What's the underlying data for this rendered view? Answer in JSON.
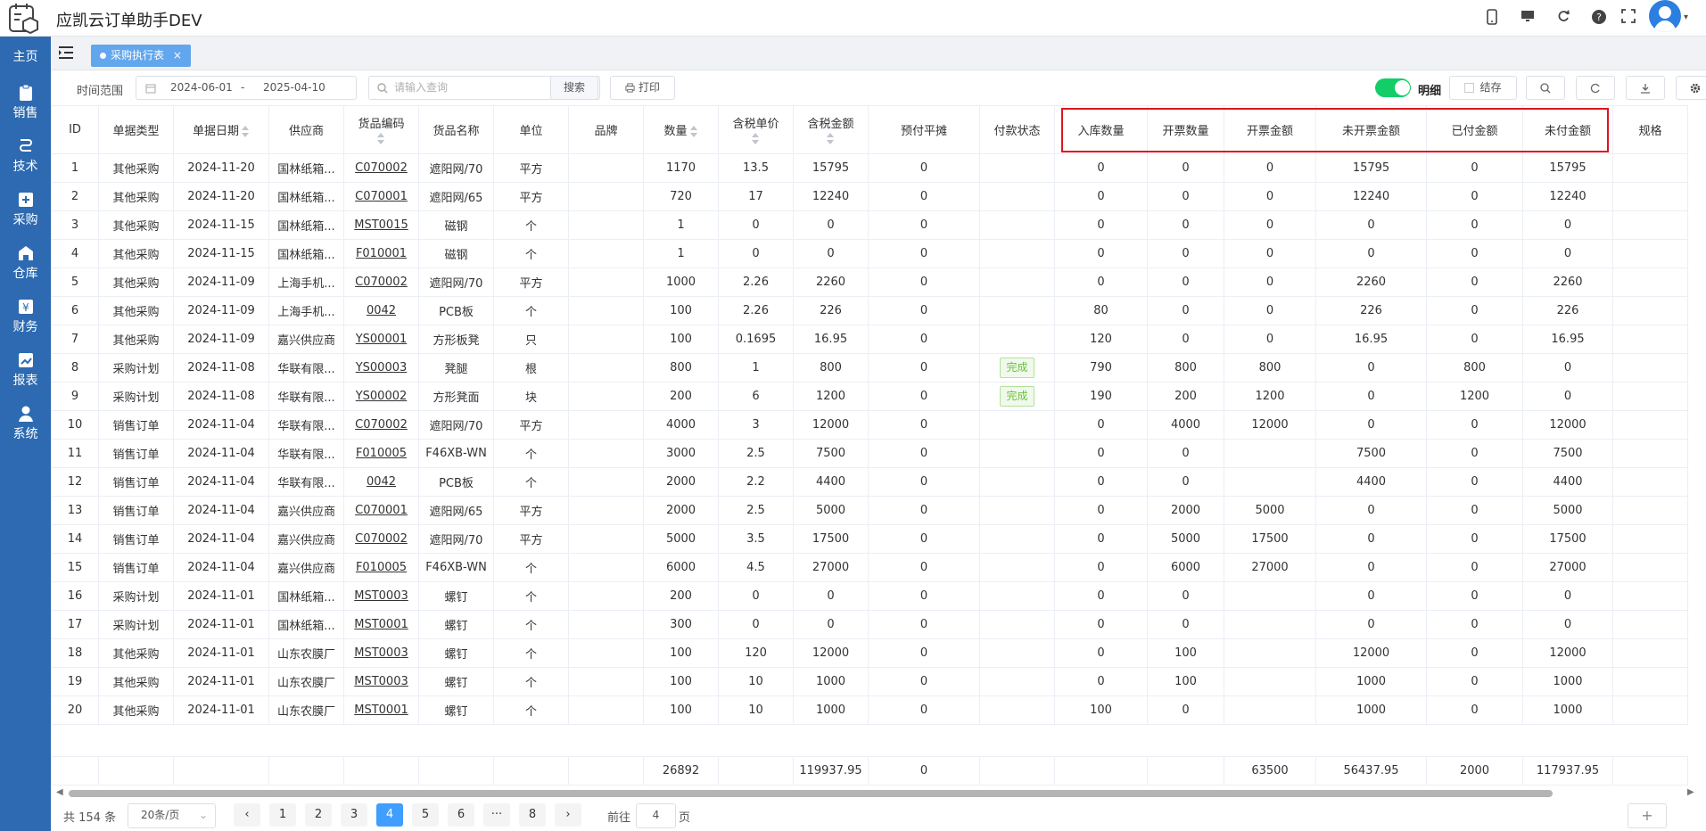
{
  "app": {
    "title": "应凯云订单助手DEV"
  },
  "sidebar": {
    "items": [
      {
        "label": "主页",
        "icon": "home-icon"
      },
      {
        "label": "销售",
        "icon": "clipboard-icon"
      },
      {
        "label": "技术",
        "icon": "route-icon"
      },
      {
        "label": "采购",
        "icon": "cart-icon"
      },
      {
        "label": "仓库",
        "icon": "warehouse-icon"
      },
      {
        "label": "财务",
        "icon": "yen-icon"
      },
      {
        "label": "报表",
        "icon": "chart-icon"
      },
      {
        "label": "系统",
        "icon": "user-icon"
      }
    ]
  },
  "tabs": {
    "active": "采购执行表",
    "close": "×"
  },
  "toolbar": {
    "date_label": "时间范围",
    "date_start": "2024-06-01",
    "date_sep": "-",
    "date_end": "2025-04-10",
    "search_placeholder": "请输入查询",
    "search_button": "搜索",
    "print_button": "打印",
    "detail_toggle_label": "明细",
    "detail_toggle_on": true,
    "settle_label": "结存"
  },
  "table": {
    "headers": [
      "ID",
      "单据类型",
      "单据日期",
      "供应商",
      "货品编码",
      "货品名称",
      "单位",
      "品牌",
      "数量",
      "含税单价",
      "含税金额",
      "预付平摊",
      "付款状态",
      "入库数量",
      "开票数量",
      "开票金额",
      "未开票金额",
      "已付金额",
      "未付金额",
      "规格"
    ],
    "rows": [
      [
        "1",
        "其他采购",
        "2024-11-20",
        "国林纸箱...",
        "C070002",
        "遮阳网/70",
        "平方",
        "",
        "1170",
        "13.5",
        "15795",
        "0",
        "",
        "0",
        "0",
        "0",
        "15795",
        "0",
        "15795",
        ""
      ],
      [
        "2",
        "其他采购",
        "2024-11-20",
        "国林纸箱...",
        "C070001",
        "遮阳网/65",
        "平方",
        "",
        "720",
        "17",
        "12240",
        "0",
        "",
        "0",
        "0",
        "0",
        "12240",
        "0",
        "12240",
        ""
      ],
      [
        "3",
        "其他采购",
        "2024-11-15",
        "国林纸箱...",
        "MST0015",
        "磁钢",
        "个",
        "",
        "1",
        "0",
        "0",
        "0",
        "",
        "0",
        "0",
        "0",
        "0",
        "0",
        "0",
        ""
      ],
      [
        "4",
        "其他采购",
        "2024-11-15",
        "国林纸箱...",
        "F010001",
        "磁钢",
        "个",
        "",
        "1",
        "0",
        "0",
        "0",
        "",
        "0",
        "0",
        "0",
        "0",
        "0",
        "0",
        ""
      ],
      [
        "5",
        "其他采购",
        "2024-11-09",
        "上海手机...",
        "C070002",
        "遮阳网/70",
        "平方",
        "",
        "1000",
        "2.26",
        "2260",
        "0",
        "",
        "0",
        "0",
        "0",
        "2260",
        "0",
        "2260",
        ""
      ],
      [
        "6",
        "其他采购",
        "2024-11-09",
        "上海手机...",
        "0042",
        "PCB板",
        "个",
        "",
        "100",
        "2.26",
        "226",
        "0",
        "",
        "80",
        "0",
        "0",
        "226",
        "0",
        "226",
        ""
      ],
      [
        "7",
        "其他采购",
        "2024-11-09",
        "嘉兴供应商",
        "YS00001",
        "方形板凳",
        "只",
        "",
        "100",
        "0.1695",
        "16.95",
        "0",
        "",
        "120",
        "0",
        "0",
        "16.95",
        "0",
        "16.95",
        ""
      ],
      [
        "8",
        "采购计划",
        "2024-11-08",
        "华联有限...",
        "YS00003",
        "凳腿",
        "根",
        "",
        "800",
        "1",
        "800",
        "0",
        "完成",
        "790",
        "800",
        "800",
        "0",
        "800",
        "0",
        ""
      ],
      [
        "9",
        "采购计划",
        "2024-11-08",
        "华联有限...",
        "YS00002",
        "方形凳面",
        "块",
        "",
        "200",
        "6",
        "1200",
        "0",
        "完成",
        "190",
        "200",
        "1200",
        "0",
        "1200",
        "0",
        ""
      ],
      [
        "10",
        "销售订单",
        "2024-11-04",
        "华联有限...",
        "C070002",
        "遮阳网/70",
        "平方",
        "",
        "4000",
        "3",
        "12000",
        "0",
        "",
        "0",
        "4000",
        "12000",
        "0",
        "0",
        "12000",
        ""
      ],
      [
        "11",
        "销售订单",
        "2024-11-04",
        "华联有限...",
        "F010005",
        "F46XB-WN",
        "个",
        "",
        "3000",
        "2.5",
        "7500",
        "0",
        "",
        "0",
        "0",
        "",
        "7500",
        "0",
        "7500",
        ""
      ],
      [
        "12",
        "销售订单",
        "2024-11-04",
        "华联有限...",
        "0042",
        "PCB板",
        "个",
        "",
        "2000",
        "2.2",
        "4400",
        "0",
        "",
        "0",
        "0",
        "",
        "4400",
        "0",
        "4400",
        ""
      ],
      [
        "13",
        "销售订单",
        "2024-11-04",
        "嘉兴供应商",
        "C070001",
        "遮阳网/65",
        "平方",
        "",
        "2000",
        "2.5",
        "5000",
        "0",
        "",
        "0",
        "2000",
        "5000",
        "0",
        "0",
        "5000",
        ""
      ],
      [
        "14",
        "销售订单",
        "2024-11-04",
        "嘉兴供应商",
        "C070002",
        "遮阳网/70",
        "平方",
        "",
        "5000",
        "3.5",
        "17500",
        "0",
        "",
        "0",
        "5000",
        "17500",
        "0",
        "0",
        "17500",
        ""
      ],
      [
        "15",
        "销售订单",
        "2024-11-04",
        "嘉兴供应商",
        "F010005",
        "F46XB-WN",
        "个",
        "",
        "6000",
        "4.5",
        "27000",
        "0",
        "",
        "0",
        "6000",
        "27000",
        "0",
        "0",
        "27000",
        ""
      ],
      [
        "16",
        "采购计划",
        "2024-11-01",
        "国林纸箱...",
        "MST0003",
        "螺钉",
        "个",
        "",
        "200",
        "0",
        "0",
        "0",
        "",
        "0",
        "0",
        "",
        "0",
        "0",
        "0",
        ""
      ],
      [
        "17",
        "采购计划",
        "2024-11-01",
        "国林纸箱...",
        "MST0001",
        "螺钉",
        "个",
        "",
        "300",
        "0",
        "0",
        "0",
        "",
        "0",
        "0",
        "",
        "0",
        "0",
        "0",
        ""
      ],
      [
        "18",
        "其他采购",
        "2024-11-01",
        "山东农膜厂",
        "MST0003",
        "螺钉",
        "个",
        "",
        "100",
        "120",
        "12000",
        "0",
        "",
        "0",
        "100",
        "",
        "12000",
        "0",
        "12000",
        ""
      ],
      [
        "19",
        "其他采购",
        "2024-11-01",
        "山东农膜厂",
        "MST0003",
        "螺钉",
        "个",
        "",
        "100",
        "10",
        "1000",
        "0",
        "",
        "0",
        "100",
        "",
        "1000",
        "0",
        "1000",
        ""
      ],
      [
        "20",
        "其他采购",
        "2024-11-01",
        "山东农膜厂",
        "MST0001",
        "螺钉",
        "个",
        "",
        "100",
        "10",
        "1000",
        "0",
        "",
        "100",
        "0",
        "",
        "1000",
        "0",
        "1000",
        ""
      ]
    ],
    "footer": [
      "",
      "",
      "",
      "",
      "",
      "",
      "",
      "",
      "26892",
      "",
      "119937.95",
      "0",
      "",
      "",
      "",
      "63500",
      "56437.95",
      "2000",
      "117937.95",
      ""
    ]
  },
  "pagination": {
    "total": "共 154 条",
    "page_size": "20条/页",
    "pages": [
      "1",
      "2",
      "3",
      "4",
      "5",
      "6",
      "···",
      "8"
    ],
    "current": "4",
    "goto_prefix": "前往",
    "goto_value": "4",
    "goto_suffix": "页",
    "add": "+"
  },
  "colors": {
    "sidebar": "#2d6ab1",
    "tab_active": "#62a6ee",
    "toggle_on": "#13ce66",
    "page_active": "#409eff",
    "badge_text": "#67c23a",
    "highlight": "#e0141e"
  }
}
